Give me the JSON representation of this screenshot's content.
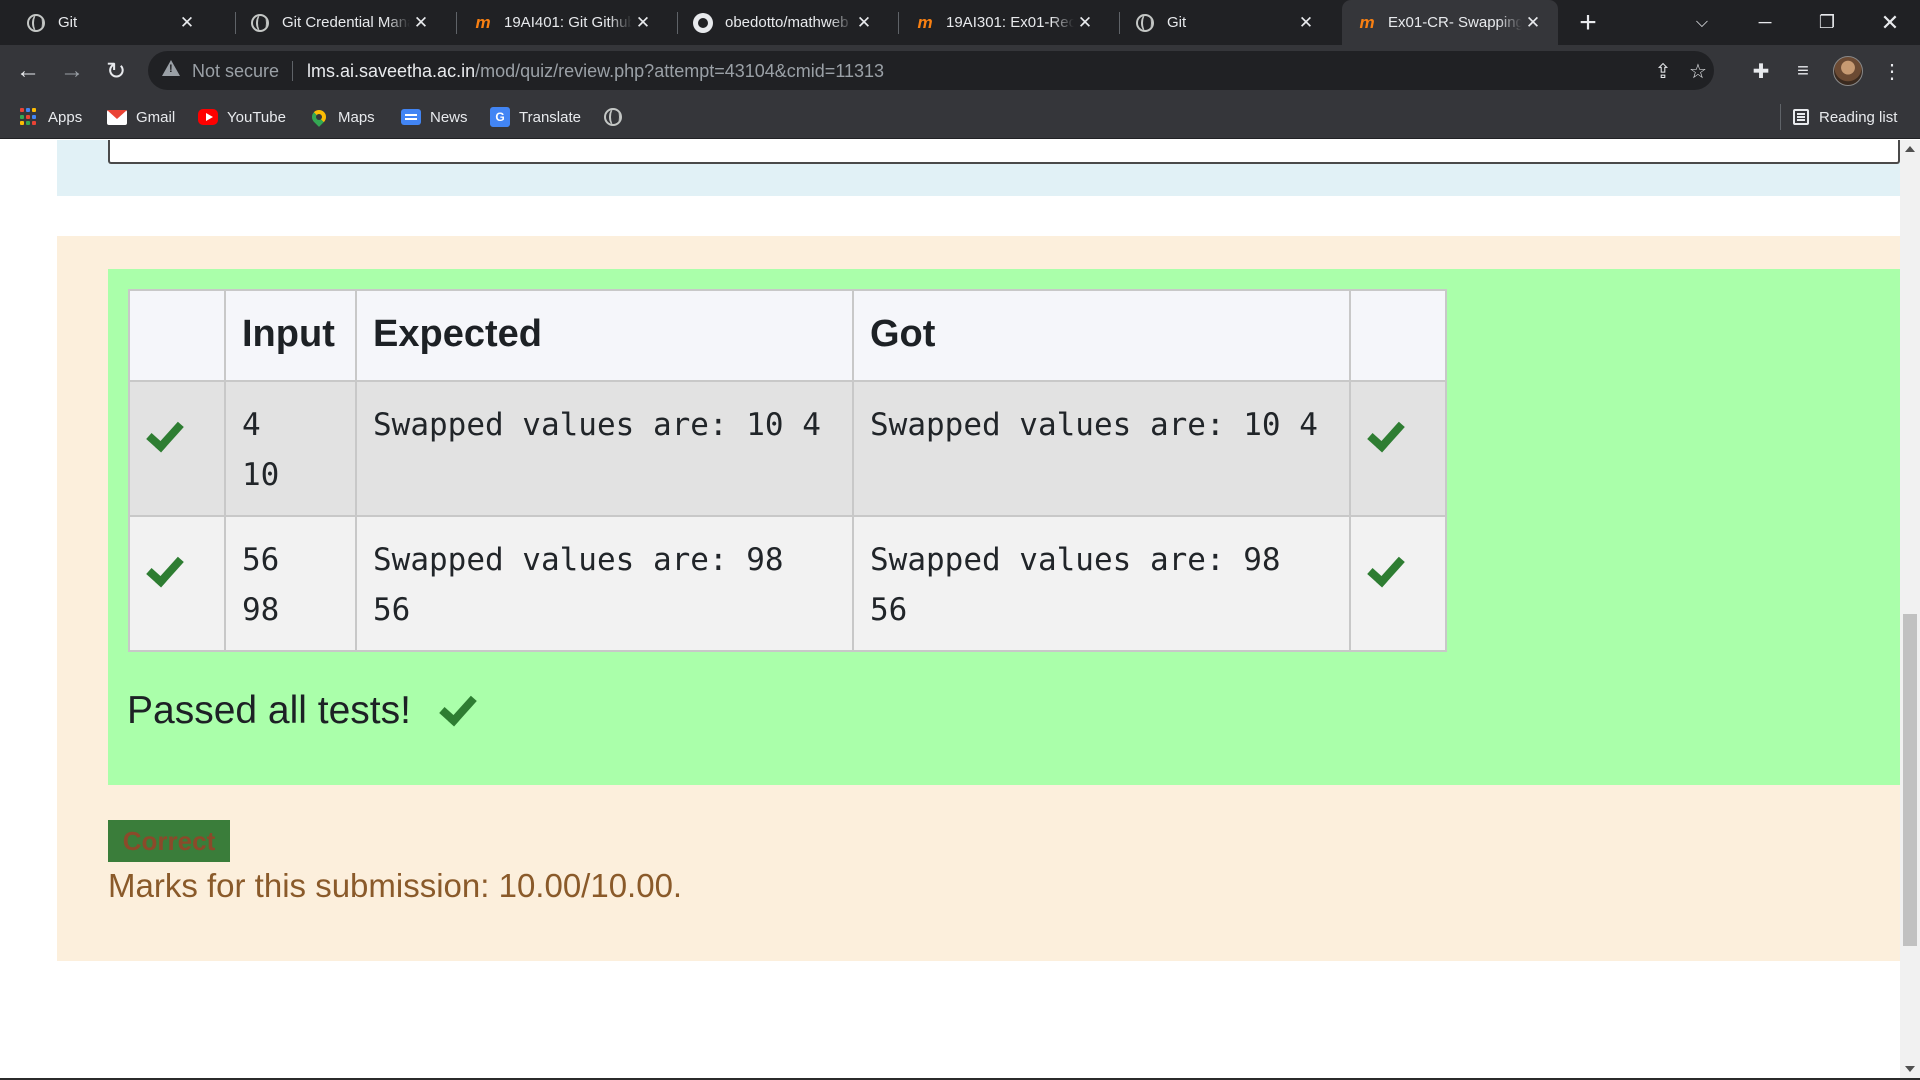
{
  "browser": {
    "tabs": [
      {
        "title": "Git",
        "icon": "globe-icon"
      },
      {
        "title": "Git Credential Manager",
        "icon": "globe-icon"
      },
      {
        "title": "19AI401: Git Github",
        "icon": "moodle-icon"
      },
      {
        "title": "obedotto/mathweb",
        "icon": "github-icon"
      },
      {
        "title": "19AI301: Ex01-Record",
        "icon": "moodle-icon"
      },
      {
        "title": "Git",
        "icon": "globe-icon"
      },
      {
        "title": "Ex01-CR- Swapping",
        "icon": "moodle-icon",
        "active": true
      }
    ],
    "omnibox": {
      "security_label": "Not secure",
      "url_host": "lms.ai.saveetha.ac.in",
      "url_path": "/mod/quiz/review.php?attempt=43104&cmid=11313"
    },
    "bookmarks": [
      {
        "label": "Apps",
        "icon": "apps-grid-icon"
      },
      {
        "label": "Gmail",
        "icon": "gmail-icon"
      },
      {
        "label": "YouTube",
        "icon": "youtube-icon"
      },
      {
        "label": "Maps",
        "icon": "maps-icon"
      },
      {
        "label": "News",
        "icon": "news-icon"
      },
      {
        "label": "Translate",
        "icon": "translate-icon"
      }
    ],
    "reading_list_label": "Reading list"
  },
  "results": {
    "headers": [
      "",
      "Input",
      "Expected",
      "Got",
      ""
    ],
    "rows": [
      {
        "input_lines": [
          "4",
          "10"
        ],
        "expected": "Swapped values are: 10 4",
        "got": "Swapped values are: 10 4",
        "passed": true
      },
      {
        "input_lines": [
          "56",
          "98"
        ],
        "expected": "Swapped values are: 98 56",
        "got": "Swapped values are: 98 56",
        "passed": true
      }
    ],
    "summary": "Passed all tests!"
  },
  "grade": {
    "badge": "Correct",
    "marks_text": "Marks for this submission: 10.00/10.00."
  },
  "colors": {
    "results_bg": "#aaffaa",
    "feedback_bg": "#fcefdc",
    "check": "#2e7d32"
  }
}
